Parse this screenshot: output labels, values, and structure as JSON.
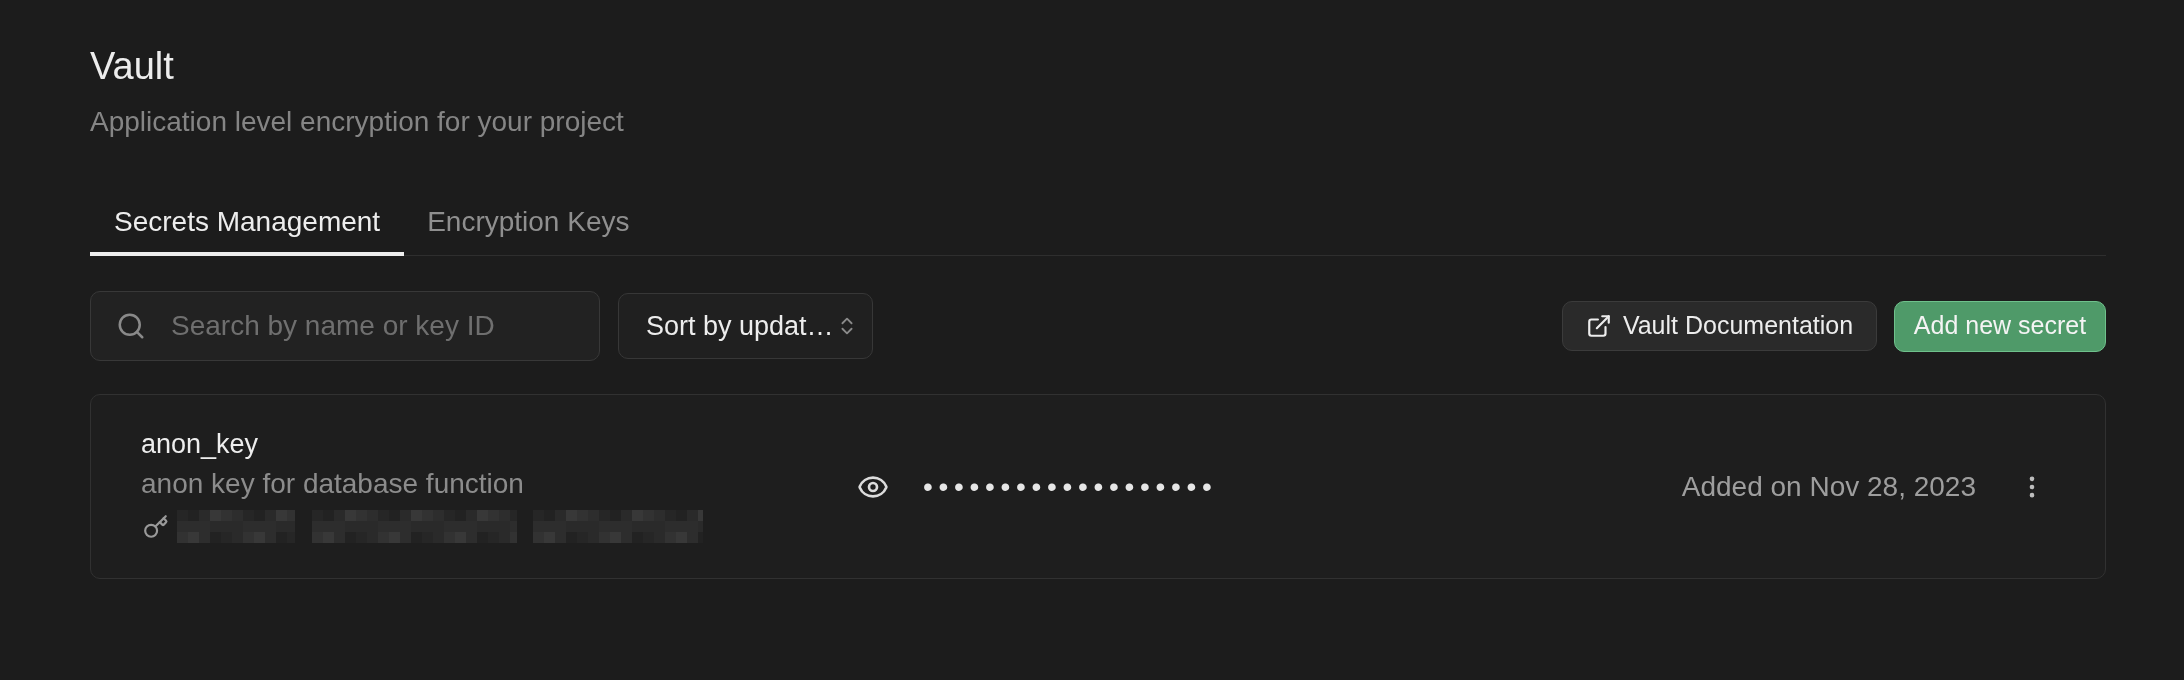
{
  "page": {
    "title": "Vault",
    "subtitle": "Application level encryption for your project"
  },
  "tabs": [
    {
      "label": "Secrets Management",
      "selected": true
    },
    {
      "label": "Encryption Keys",
      "selected": false
    }
  ],
  "toolbar": {
    "search": {
      "placeholder": "Search by name or key ID"
    },
    "sort": {
      "value": "Sort by updat…"
    },
    "buttons": [
      {
        "label": "Vault Documentation",
        "kind": "link"
      },
      {
        "label": "Add new secret",
        "kind": "primary"
      }
    ]
  },
  "secrets": [
    {
      "name": "anon_key",
      "description": "anon key for database function",
      "masked_value": "•••••••••••••••••••",
      "added": "Added on Nov 28, 2023"
    }
  ]
}
